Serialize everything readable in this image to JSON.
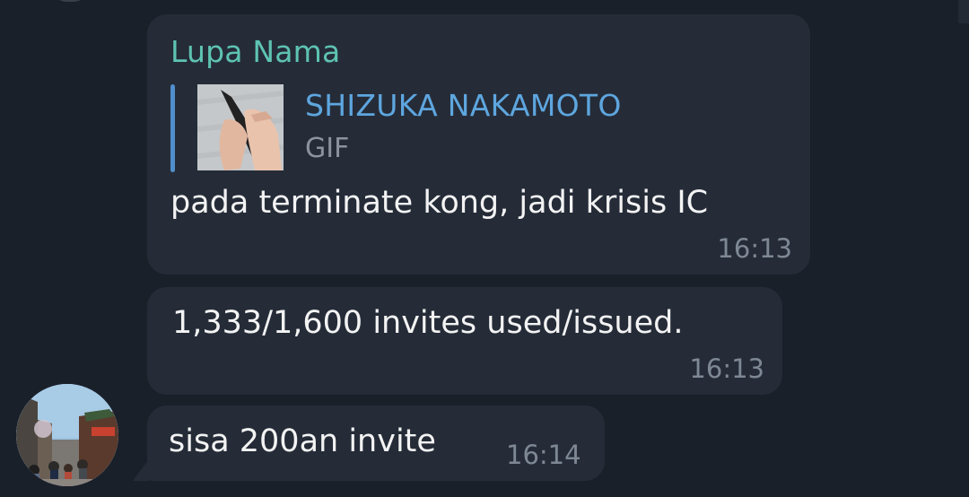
{
  "messages": [
    {
      "sender": "Lupa Nama",
      "reply": {
        "name": "SHIZUKA NAKAMOTO",
        "type": "GIF"
      },
      "text": "pada terminate kong, jadi krisis IC",
      "time": "16:13"
    },
    {
      "text": "1,333/1,600 invites used/issued.",
      "time": "16:13"
    },
    {
      "text": "sisa 200an invite",
      "time": "16:14"
    }
  ],
  "colors": {
    "background": "#1a202a",
    "bubble": "#252c38",
    "sender": "#5ec3b2",
    "reply_name": "#5ea6df",
    "reply_bar": "#4f8fcb",
    "timestamp": "#7e8894"
  },
  "icons": {
    "reply_thumbnail": "gif-thumbnail-hands",
    "avatar": "street-photo-avatar"
  }
}
